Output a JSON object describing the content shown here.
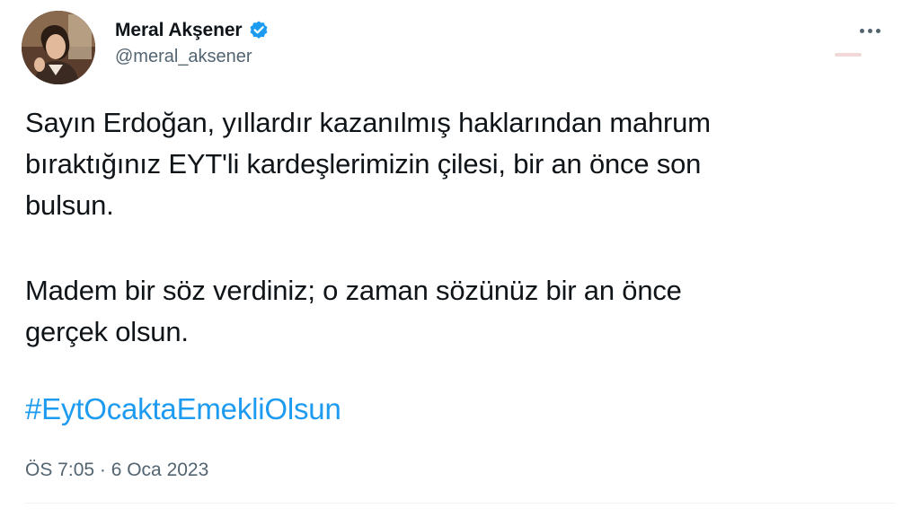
{
  "tweet": {
    "display_name": "Meral Akşener",
    "handle": "@meral_aksener",
    "paragraph_1": "Sayın Erdoğan, yıllardır kazanılmış haklarından mahrum\nbıraktığınız EYT'li kardeşlerimizin çilesi, bir an önce son\nbulsun.",
    "paragraph_2": "Madem bir söz verdiniz; o zaman sözünüz bir an önce\ngerçek olsun.",
    "hashtag": "#EytOcaktaEmekliOlsun",
    "timestamp": "ÖS 7:05 · 6 Oca 2023"
  },
  "icons": {
    "verified": "verified-badge-icon",
    "more": "more-options-icon"
  },
  "colors": {
    "link": "#1d9bf0",
    "secondary_text": "#536471",
    "primary_text": "#0f1419",
    "verified": "#1d9bf0"
  }
}
